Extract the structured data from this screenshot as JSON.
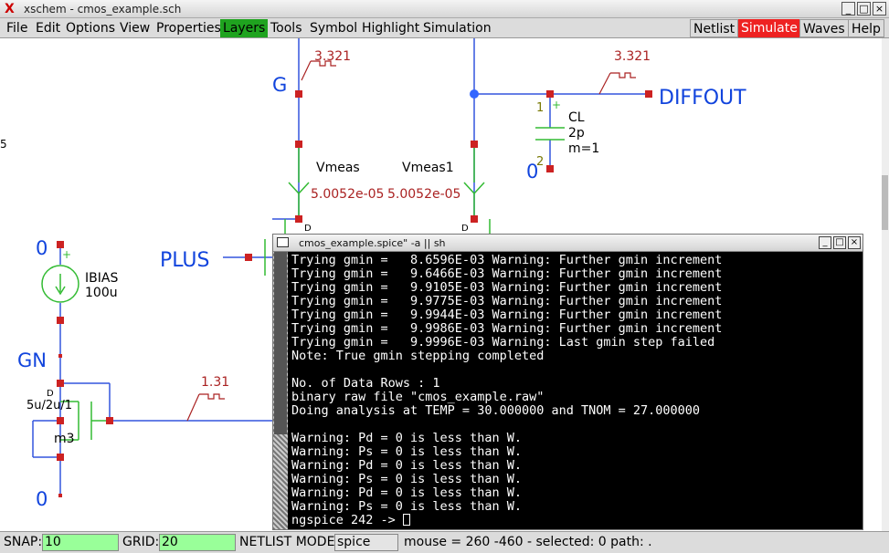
{
  "window": {
    "title": "xschem - cmos_example.sch",
    "logo": "X"
  },
  "window_controls": [
    "_",
    "□",
    "×"
  ],
  "menu": {
    "items": [
      "File",
      "Edit",
      "Options",
      "View",
      "Properties",
      "Layers",
      "Tools",
      "Symbol",
      "Highlight",
      "Simulation"
    ],
    "active": "Layers",
    "right_items": [
      "Netlist",
      "Simulate",
      "Waves",
      "Help"
    ]
  },
  "colors": {
    "wire": "#3355dd",
    "pin": "#cc2222",
    "label": "#1144dd",
    "value": "#aa2222",
    "component": "#33bb33",
    "bullet": "#3366ff",
    "active_menu": "#1fa31f",
    "simulate": "#ee2222",
    "status_field": "#99ff99"
  },
  "schematic": {
    "labels": {
      "g": "G",
      "diffout": "DIFFOUT",
      "plus": "PLUS",
      "gn": "GN",
      "zero1": "0",
      "zero2": "0",
      "zero3": "0"
    },
    "probes": {
      "g_voltage": "3.321",
      "diffout_voltage": "3.321",
      "gn_voltage": "1.31"
    },
    "vmeas": {
      "name": "Vmeas",
      "value": "5.0052e-05"
    },
    "vmeas1": {
      "name": "Vmeas1",
      "value": "5.0052e-05"
    },
    "cl": {
      "name": "CL",
      "value": "2p",
      "mult": "m=1",
      "pin1": "1",
      "pin2": "2",
      "plus": "+"
    },
    "ibias": {
      "name": "IBIAS",
      "value": "100u",
      "plus": "+"
    },
    "m3": {
      "name": "m3",
      "size": "5u/2u/1",
      "drain": "D"
    },
    "drain_mark_1": "D",
    "drain_mark_2": "D",
    "edge_mark": "5"
  },
  "terminal": {
    "title": "cmos_example.spice\" -a || sh",
    "controls": [
      "_",
      "□",
      "×"
    ],
    "lines": [
      "Trying gmin =   8.6596E-03 Warning: Further gmin increment",
      "Trying gmin =   9.6466E-03 Warning: Further gmin increment",
      "Trying gmin =   9.9105E-03 Warning: Further gmin increment",
      "Trying gmin =   9.9775E-03 Warning: Further gmin increment",
      "Trying gmin =   9.9944E-03 Warning: Further gmin increment",
      "Trying gmin =   9.9986E-03 Warning: Further gmin increment",
      "Trying gmin =   9.9996E-03 Warning: Last gmin step failed",
      "Note: True gmin stepping completed",
      "",
      "No. of Data Rows : 1",
      "binary raw file \"cmos_example.raw\"",
      "Doing analysis at TEMP = 30.000000 and TNOM = 27.000000",
      "",
      "Warning: Pd = 0 is less than W.",
      "Warning: Ps = 0 is less than W.",
      "Warning: Pd = 0 is less than W.",
      "Warning: Ps = 0 is less than W.",
      "Warning: Pd = 0 is less than W.",
      "Warning: Ps = 0 is less than W."
    ],
    "prompt": "ngspice 242 -> "
  },
  "status": {
    "snap_label": "SNAP:",
    "snap_value": "10",
    "grid_label": "GRID:",
    "grid_value": "20",
    "netlist_label": "NETLIST MODE:",
    "netlist_value": "spice",
    "info": "mouse = 260 -460 - selected: 0 path: ."
  }
}
